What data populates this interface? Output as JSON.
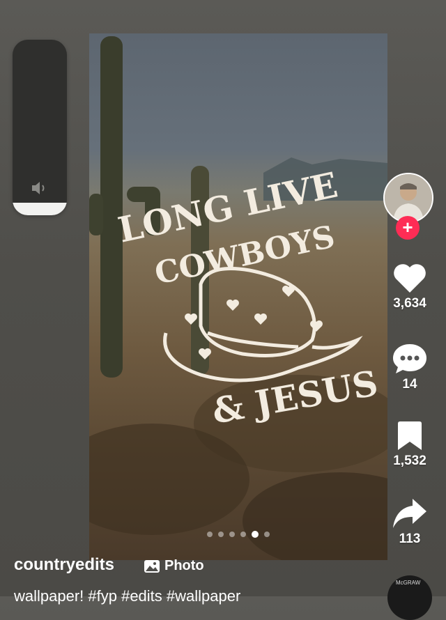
{
  "post": {
    "username": "countryedits",
    "type_label": "Photo",
    "caption": "wallpaper! #fyp #edits #wallpaper"
  },
  "artwork_text": {
    "line1": "LONG LIVE",
    "line2": "COWBOYS",
    "line3": "& JESUS"
  },
  "volume": {
    "level": 0.07
  },
  "carousel": {
    "total": 6,
    "active_index": 4
  },
  "actions": {
    "likes": "3,634",
    "comments": "14",
    "saves": "1,532",
    "shares": "113"
  },
  "music": {
    "label": "McGRAW"
  },
  "colors": {
    "follow_badge": "#fe2c55",
    "accent_text": "#f3ece0"
  }
}
